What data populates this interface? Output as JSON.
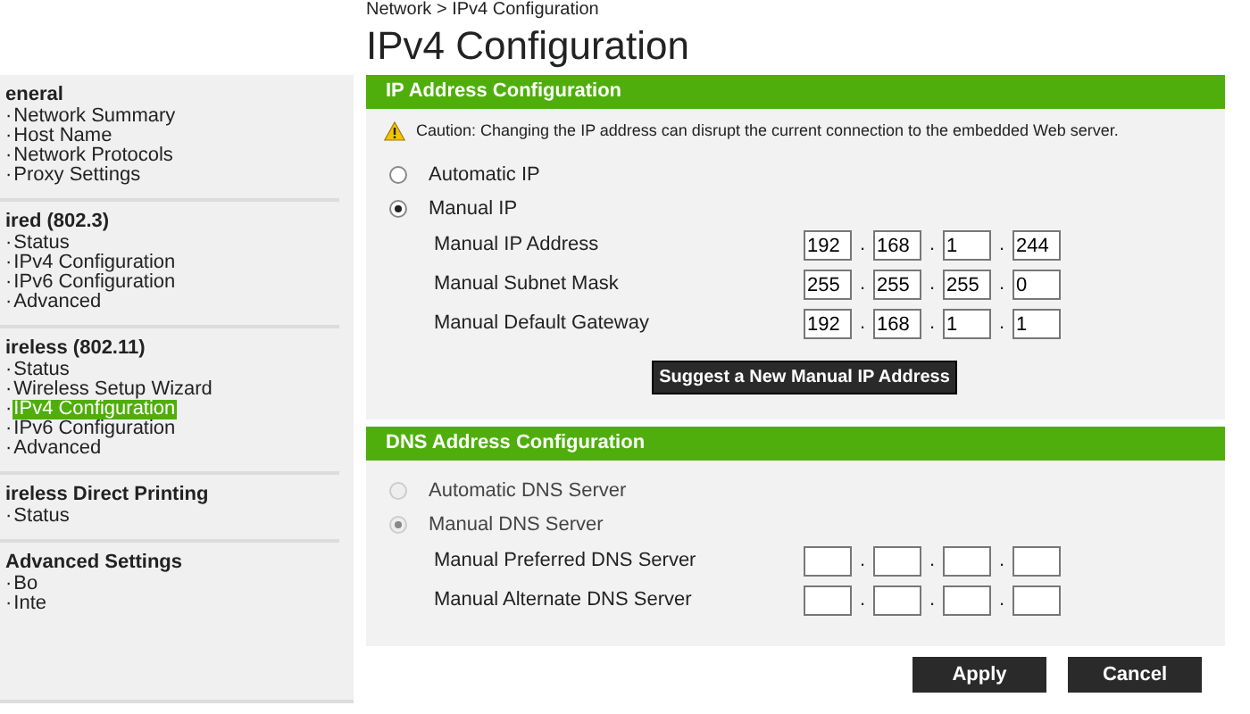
{
  "breadcrumb": "Network > IPv4 Configuration",
  "title": "IPv4 Configuration",
  "sidebar": {
    "bullet": "·",
    "sections": [
      {
        "heading": "eneral",
        "items": [
          {
            "label": "Network Summary",
            "selected": false
          },
          {
            "label": "Host Name",
            "selected": false
          },
          {
            "label": "Network Protocols",
            "selected": false
          },
          {
            "label": "Proxy Settings",
            "selected": false
          }
        ]
      },
      {
        "heading": "ired (802.3)",
        "items": [
          {
            "label": "Status",
            "selected": false
          },
          {
            "label": "IPv4 Configuration",
            "selected": false
          },
          {
            "label": "IPv6 Configuration",
            "selected": false
          },
          {
            "label": "Advanced",
            "selected": false
          }
        ]
      },
      {
        "heading": "ireless (802.11)",
        "items": [
          {
            "label": "Status",
            "selected": false
          },
          {
            "label": "Wireless Setup Wizard",
            "selected": false
          },
          {
            "label": "IPv4 Configuration",
            "selected": true
          },
          {
            "label": "IPv6 Configuration",
            "selected": false
          },
          {
            "label": "Advanced",
            "selected": false
          }
        ]
      },
      {
        "heading": "ireless Direct Printing",
        "items": [
          {
            "label": "Status",
            "selected": false
          }
        ]
      },
      {
        "heading": "Advanced Settings",
        "items": [
          {
            "label": "Bo",
            "selected": false
          },
          {
            "label": "Inte",
            "selected": false
          }
        ]
      }
    ]
  },
  "ip_section": {
    "heading": "IP Address Configuration",
    "caution": "Caution: Changing the IP address can disrupt the current connection to the embedded Web server.",
    "separator": ".",
    "options": [
      {
        "label": "Automatic IP",
        "selected": false,
        "disabled": false
      },
      {
        "label": "Manual IP",
        "selected": true,
        "disabled": false
      }
    ],
    "fields": [
      {
        "label": "Manual IP Address",
        "octets": [
          {
            "value": "192"
          },
          {
            "value": "168"
          },
          {
            "value": "1"
          },
          {
            "value": "244"
          }
        ]
      },
      {
        "label": "Manual Subnet Mask",
        "octets": [
          {
            "value": "255"
          },
          {
            "value": "255"
          },
          {
            "value": "255"
          },
          {
            "value": "0"
          }
        ]
      },
      {
        "label": "Manual Default Gateway",
        "octets": [
          {
            "value": "192"
          },
          {
            "value": "168"
          },
          {
            "value": "1"
          },
          {
            "value": "1"
          }
        ]
      }
    ],
    "suggest_button": "Suggest a New Manual IP Address"
  },
  "dns_section": {
    "heading": "DNS Address Configuration",
    "separator": ".",
    "options": [
      {
        "label": "Automatic DNS Server",
        "selected": false,
        "disabled": true
      },
      {
        "label": "Manual DNS Server",
        "selected": true,
        "disabled": true
      }
    ],
    "fields": [
      {
        "label": "Manual Preferred DNS Server",
        "octets": [
          {
            "kind": "empty"
          },
          {
            "kind": "empty"
          },
          {
            "kind": "empty"
          },
          {
            "kind": "empty"
          }
        ]
      },
      {
        "label": "Manual Alternate DNS Server",
        "octets": [
          {
            "kind": "empty"
          },
          {
            "kind": "empty"
          },
          {
            "kind": "empty"
          },
          {
            "kind": "empty"
          }
        ]
      }
    ]
  },
  "buttons": [
    "Apply",
    "Cancel"
  ]
}
